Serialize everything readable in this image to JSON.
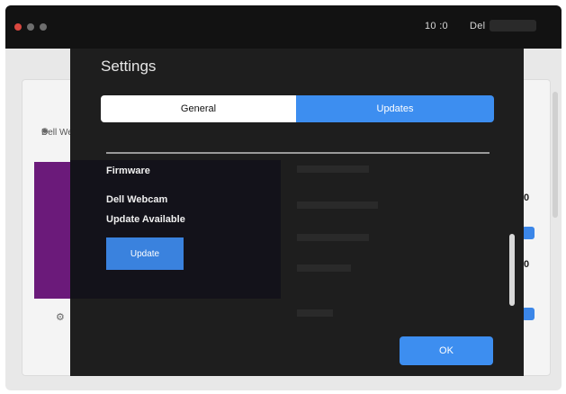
{
  "titlebar": {
    "clock": "10 :0",
    "user": "Del"
  },
  "background": {
    "camera_label": "Dell Webcam",
    "right_values": [
      "0",
      "0"
    ]
  },
  "dialog": {
    "title": "Settings",
    "tabs": [
      {
        "label": "General",
        "selected": false
      },
      {
        "label": "Updates",
        "selected": true
      }
    ],
    "firmware": {
      "heading": "Firmware",
      "device": "Dell Webcam",
      "status": "Update Available",
      "update_button": "Update"
    },
    "ok_button": "OK"
  },
  "colors": {
    "accent": "#3d8ef0",
    "dialog_bg": "#1e1e1e",
    "titlebar_bg": "#121212",
    "purple": "#6b1a7a"
  }
}
